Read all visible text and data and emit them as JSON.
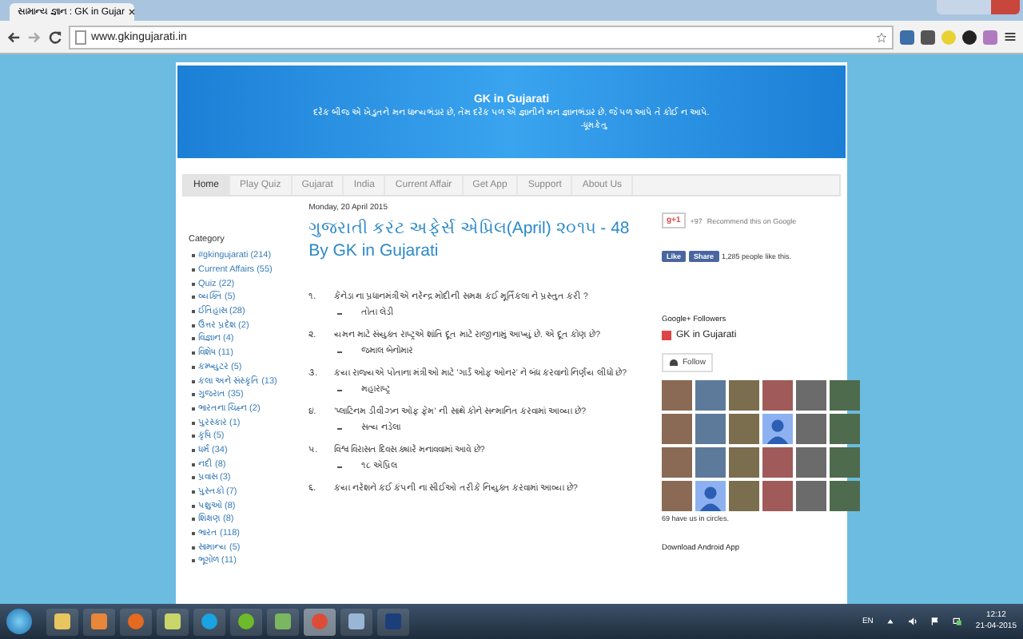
{
  "browser": {
    "tab_title": "સામાન્ય જ્ઞાન : GK in Gujar",
    "address": "www.gkingujarati.in"
  },
  "header": {
    "title": "GK in Gujarati",
    "quote": "દરેક બીજ એ ખેડુતને મન ધાન્યભંડાર છે, તેમ દરેક પળ એ જ્ઞાનીને મન જ્ઞાનભંડાર છે. જે પળ આપે તે કોઈ ન આપે.",
    "author": "-ધૂમકેતુ"
  },
  "nav": [
    {
      "label": "Home",
      "selected": true
    },
    {
      "label": "Play Quiz",
      "selected": false
    },
    {
      "label": "Gujarat",
      "selected": false
    },
    {
      "label": "India",
      "selected": false
    },
    {
      "label": "Current Affair",
      "selected": false
    },
    {
      "label": "Get App",
      "selected": false
    },
    {
      "label": "Support",
      "selected": false
    },
    {
      "label": "About Us",
      "selected": false
    }
  ],
  "sidebar": {
    "heading": "Category",
    "items": [
      "#gkingujarati (214)",
      "Current Affairs (55)",
      "Quiz (22)",
      "વ્યક્તિ (5)",
      "ઈતિહાસ (28)",
      "ઉત્તર પ્રદેશ (2)",
      "વિજ્ઞાન (4)",
      "વિશેષ (11)",
      "કમ્પ્યુટર (5)",
      "કલા અને સંસ્કૃતિ (13)",
      "ગુજરાત (35)",
      "ભારતના ચિહ્ન (2)",
      "પુરસ્કાર (1)",
      "કૃષિ (5)",
      "ધર્મ (34)",
      "નદી (8)",
      "પ્રવાસ (3)",
      "પુસ્તકો (7)",
      "પશુઓ (8)",
      "શિક્ષણ (8)",
      "ભારત (118)",
      "સામાન્ય (5)",
      "ભૂગોળ (11)"
    ]
  },
  "post": {
    "date": "Monday, 20 April 2015",
    "title": "ગુજરાતી કરંટ અફેર્સ એપ્રિલ(April) ૨૦૧૫ - 48 By GK in Gujarati",
    "questions": [
      {
        "number": "૧.",
        "text": "કેનેડા ના પ્રધાનમંત્રીએ નરેન્દ્ર મોદીની સમક્ષ કઈ મૂર્તિકલા ને પ્રસ્તુત કરી ?",
        "answer": "તોતા લેડી"
      },
      {
        "number": "૨.",
        "text": "યમન માટે સંયુક્ત રાષ્ટ્રએ શાંતિ દૂત માટે રાજીનામું આપ્યું છે. એ દૂત કોણ છે?",
        "answer": "જમાલ બેનોમાર"
      },
      {
        "number": "૩.",
        "text": "કયા રાજ્યએ પોતાના મંત્રીઓ માટે 'ગાર્ડ ઓફ ઓનર' ને બંધ કરવાનો નિર્ણય લીધો છે?",
        "answer": "મહારાષ્ટ્ર"
      },
      {
        "number": "૪.",
        "text": "'પ્લાટિનમ ડીવીઝન ઓફ ફેમ' ની સાથે કોને સન્માનિત કરવામાં આવ્યા છે?",
        "answer": "સત્ય નડેલા"
      },
      {
        "number": "૫.",
        "text": "વિશ્વ વિરાસત દિવસ ક્યારે મનાવવામાં આવે છે?",
        "answer": "૧૮ એપ્રિલ"
      },
      {
        "number": "૬.",
        "text": "કયા નરેશને કઈ કંપની ના સીઈઓ તરીકે નિયુક્ત કરવામાં આવ્યા છે?"
      }
    ]
  },
  "right": {
    "gplus_label": "g+1",
    "gplus_count": "+97",
    "recommend": "Recommend this on Google",
    "like": "Like",
    "share": "Share",
    "likes_text": "1,285 people like this.",
    "followers_heading": "Google+ Followers",
    "profile_name": "GK in Gujarati",
    "follow": "Follow",
    "followers": [
      {
        "kind": "photo"
      },
      {
        "kind": "photo"
      },
      {
        "kind": "photo"
      },
      {
        "kind": "photo"
      },
      {
        "kind": "photo"
      },
      {
        "kind": "photo"
      },
      {
        "kind": "photo"
      },
      {
        "kind": "photo"
      },
      {
        "kind": "photo"
      },
      {
        "kind": "silhouette"
      },
      {
        "kind": "photo"
      },
      {
        "kind": "photo"
      },
      {
        "kind": "photo"
      },
      {
        "kind": "photo"
      },
      {
        "kind": "photo"
      },
      {
        "kind": "photo"
      },
      {
        "kind": "photo"
      },
      {
        "kind": "photo"
      },
      {
        "kind": "photo"
      },
      {
        "kind": "silhouette"
      },
      {
        "kind": "photo"
      },
      {
        "kind": "photo"
      },
      {
        "kind": "photo"
      },
      {
        "kind": "photo"
      }
    ],
    "circles_text": "69 have us in circles.",
    "app_heading": "Download Android App"
  },
  "taskbar": {
    "apps": [
      {
        "kind": "folder",
        "selected": false
      },
      {
        "kind": "media",
        "selected": false
      },
      {
        "kind": "firefox",
        "selected": false
      },
      {
        "kind": "notes",
        "selected": false
      },
      {
        "kind": "skype",
        "selected": false
      },
      {
        "kind": "green",
        "selected": false
      },
      {
        "kind": "document",
        "selected": false
      },
      {
        "kind": "chrome",
        "selected": true
      },
      {
        "kind": "paint",
        "selected": false
      },
      {
        "kind": "photoshop",
        "selected": false
      }
    ],
    "language": "EN",
    "time": "12:12",
    "date": "21-04-2015"
  }
}
